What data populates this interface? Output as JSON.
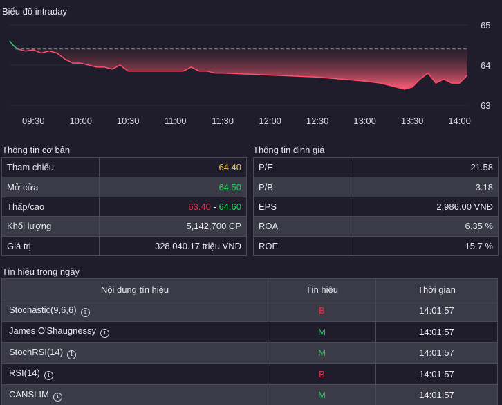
{
  "chart": {
    "title": "Biểu đồ intraday",
    "reference_price": 64.4,
    "y_ticks": [
      "65",
      "64",
      "63"
    ],
    "y_values": [
      65,
      64,
      63
    ],
    "x_ticks": [
      "09:30",
      "10:00",
      "10:30",
      "11:00",
      "11:30",
      "12:00",
      "12:30",
      "13:00",
      "13:30",
      "14:00"
    ],
    "colors": {
      "up": "#24d05a",
      "down": "#ff4d6a",
      "reference_line": "#8a8a96",
      "grid": "#2e2c3b"
    }
  },
  "chart_data": {
    "type": "area",
    "x_start": "09:15",
    "x_end": "14:05",
    "ylim": [
      63,
      65
    ],
    "baseline": 64.4,
    "points": [
      [
        "09:15",
        64.6
      ],
      [
        "09:17",
        64.5
      ],
      [
        "09:20",
        64.4
      ],
      [
        "09:25",
        64.35
      ],
      [
        "09:30",
        64.38
      ],
      [
        "09:35",
        64.3
      ],
      [
        "09:40",
        64.35
      ],
      [
        "09:45",
        64.3
      ],
      [
        "09:50",
        64.15
      ],
      [
        "09:55",
        64.05
      ],
      [
        "10:00",
        64.05
      ],
      [
        "10:05",
        64.0
      ],
      [
        "10:10",
        63.95
      ],
      [
        "10:15",
        63.95
      ],
      [
        "10:20",
        63.9
      ],
      [
        "10:25",
        64.0
      ],
      [
        "10:30",
        63.85
      ],
      [
        "10:40",
        63.85
      ],
      [
        "10:50",
        63.85
      ],
      [
        "11:00",
        63.85
      ],
      [
        "11:05",
        63.85
      ],
      [
        "11:10",
        63.95
      ],
      [
        "11:15",
        63.85
      ],
      [
        "11:20",
        63.85
      ],
      [
        "11:25",
        63.8
      ],
      [
        "11:30",
        63.8
      ],
      [
        "12:00",
        63.75
      ],
      [
        "12:30",
        63.7
      ],
      [
        "13:00",
        63.6
      ],
      [
        "13:10",
        63.55
      ],
      [
        "13:15",
        63.5
      ],
      [
        "13:20",
        63.45
      ],
      [
        "13:25",
        63.4
      ],
      [
        "13:30",
        63.45
      ],
      [
        "13:35",
        63.65
      ],
      [
        "13:40",
        63.8
      ],
      [
        "13:45",
        63.55
      ],
      [
        "13:50",
        63.65
      ],
      [
        "13:55",
        63.55
      ],
      [
        "14:00",
        63.55
      ],
      [
        "14:05",
        63.75
      ]
    ]
  },
  "basic": {
    "title": "Thông tin cơ bản",
    "rows": [
      {
        "label": "Tham chiếu",
        "value": "64.40"
      },
      {
        "label": "Mở cửa",
        "value": "64.50"
      },
      {
        "label": "Thấp/cao",
        "low": "63.40",
        "sep": " - ",
        "high": "64.60"
      },
      {
        "label": "Khối lượng",
        "value": "5,142,700 CP"
      },
      {
        "label": "Giá trị",
        "value": "328,040.17 triệu VNĐ"
      }
    ]
  },
  "valuation": {
    "title": "Thông tin định giá",
    "rows": [
      {
        "label": "P/E",
        "value": "21.58"
      },
      {
        "label": "P/B",
        "value": "3.18"
      },
      {
        "label": "EPS",
        "value": "2,986.00 VNĐ"
      },
      {
        "label": "ROA",
        "value": "6.35 %"
      },
      {
        "label": "ROE",
        "value": "15.7 %"
      }
    ]
  },
  "signals": {
    "title": "Tín hiệu trong ngày",
    "headers": [
      "Nội dung tín hiệu",
      "Tín hiệu",
      "Thời gian"
    ],
    "info_glyph": "i",
    "rows": [
      {
        "name": "Stochastic(9,6,6)",
        "signal": "B",
        "time": "14:01:57"
      },
      {
        "name": "James O'Shaugnessy",
        "signal": "M",
        "time": "14:01:57"
      },
      {
        "name": "StochRSI(14)",
        "signal": "M",
        "time": "14:01:57"
      },
      {
        "name": "RSI(14)",
        "signal": "B",
        "time": "14:01:57"
      },
      {
        "name": "CANSLIM",
        "signal": "M",
        "time": "14:01:57"
      }
    ]
  }
}
